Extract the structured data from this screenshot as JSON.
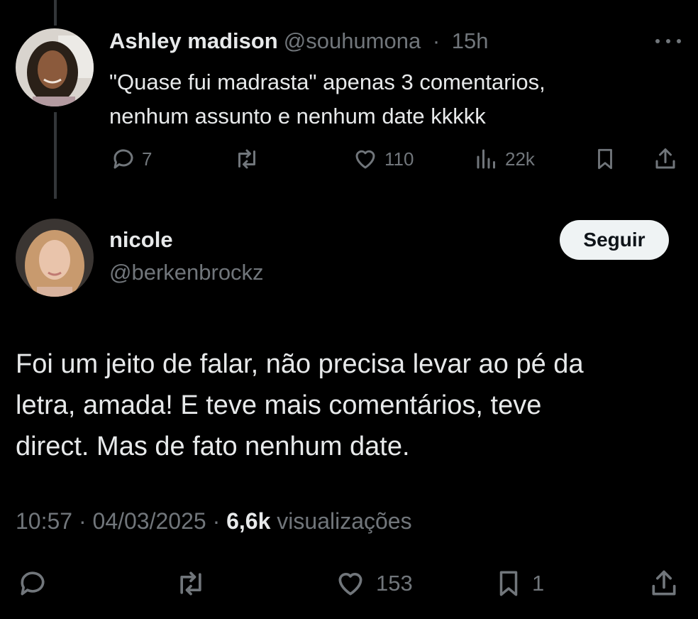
{
  "reply_to": {
    "name": "Ashley madison",
    "handle": "@souhumona",
    "time": "15h",
    "text_line1": "\"Quase fui madrasta\" apenas 3 comentarios,",
    "text_line2": "nenhum assunto e nenhum date kkkkk",
    "replies": "7",
    "likes": "110",
    "views": "22k"
  },
  "tweet": {
    "name": "nicole",
    "handle": "@berkenbrockz",
    "follow_label": "Seguir",
    "text_line1": "Foi um jeito de falar, não precisa levar ao pé da",
    "text_line2": "letra, amada! E teve mais comentários, teve",
    "text_line3": "direct. Mas de fato nenhum date.",
    "time": "10:57",
    "date": "04/03/2025",
    "views": "6,6k",
    "views_label": "visualizações",
    "likes": "153",
    "bookmarks": "1"
  },
  "icons": [
    "reply-icon",
    "retweet-icon",
    "like-icon",
    "views-icon",
    "bookmark-icon",
    "share-icon",
    "more-icon"
  ]
}
